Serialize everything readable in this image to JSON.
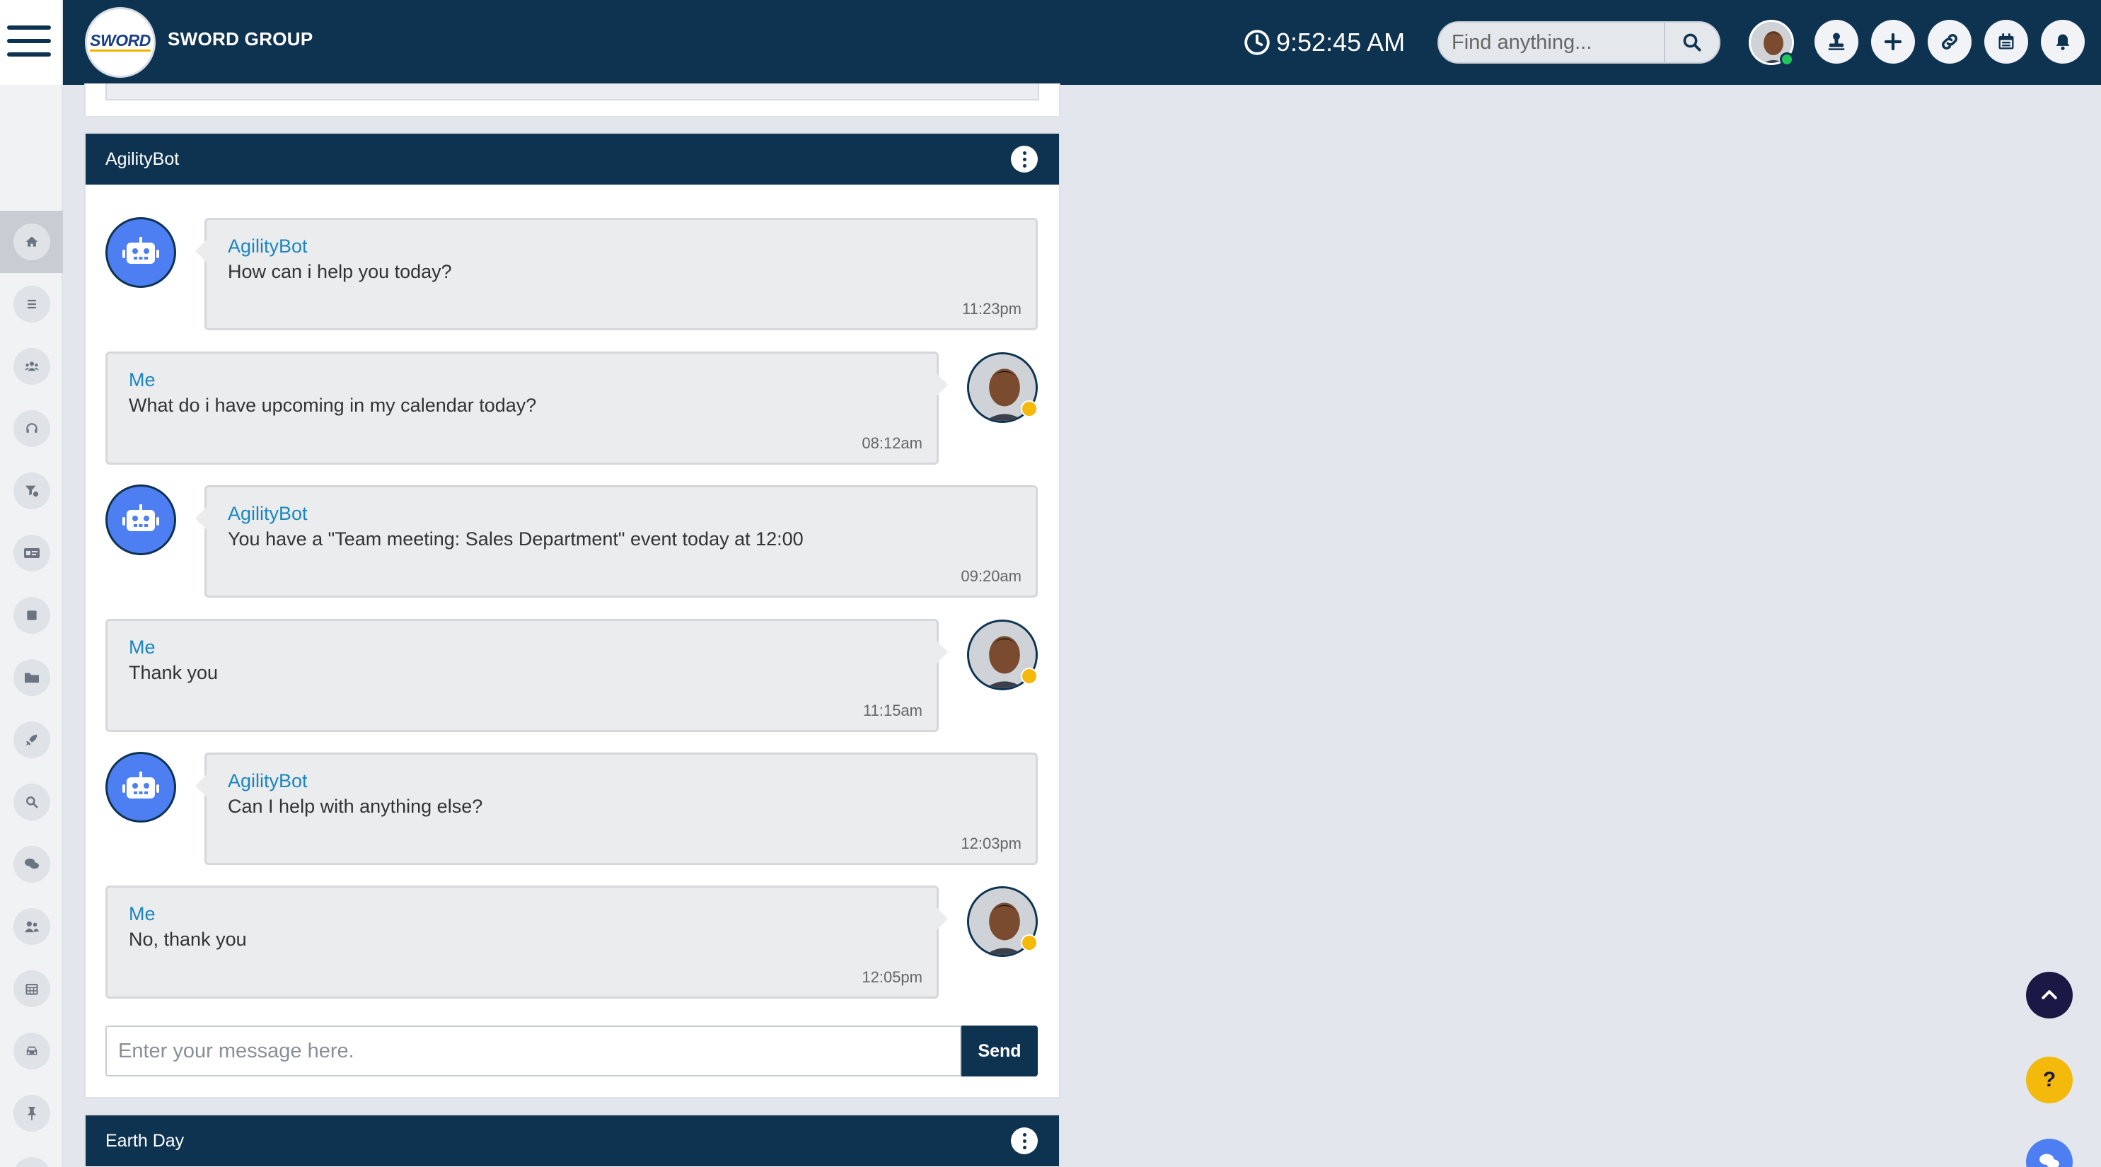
{
  "header": {
    "company": "SWORD GROUP",
    "logo_text": "SWORD",
    "clock": "9:52:45 AM",
    "search_placeholder": "Find anything..."
  },
  "agility_panel": {
    "title": "AgilityBot",
    "messages": [
      {
        "sender": "AgilityBot",
        "text": "How can i help you today?",
        "time": "11:23pm"
      },
      {
        "sender": "Me",
        "text": "What do i have upcoming in my calendar today?",
        "time": "08:12am"
      },
      {
        "sender": "AgilityBot",
        "text": "You have a \"Team meeting: Sales Department\" event today at 12:00",
        "time": "09:20am"
      },
      {
        "sender": "Me",
        "text": "Thank you",
        "time": "11:15am"
      },
      {
        "sender": "AgilityBot",
        "text": "Can I help with anything else?",
        "time": "12:03pm"
      },
      {
        "sender": "Me",
        "text": "No, thank you",
        "time": "12:05pm"
      }
    ],
    "composer_placeholder": "Enter your message here.",
    "send_label": "Send"
  },
  "earth_panel": {
    "title": "Earth Day"
  },
  "help_label": "?",
  "colors": {
    "navy": "#0e3351",
    "bot_blue": "#4d7ef2",
    "name_blue": "#1b86bd",
    "help_yellow": "#f3b90b",
    "online": "#22c55e"
  },
  "sidebar_icons": [
    "home-icon",
    "list-icon",
    "team-icon",
    "support-icon",
    "filter-icon",
    "id-card-icon",
    "stop-icon",
    "folder-icon",
    "rocket-icon",
    "search-icon",
    "chat-icon",
    "users-icon",
    "calendar-icon",
    "car-icon",
    "pin-icon"
  ]
}
